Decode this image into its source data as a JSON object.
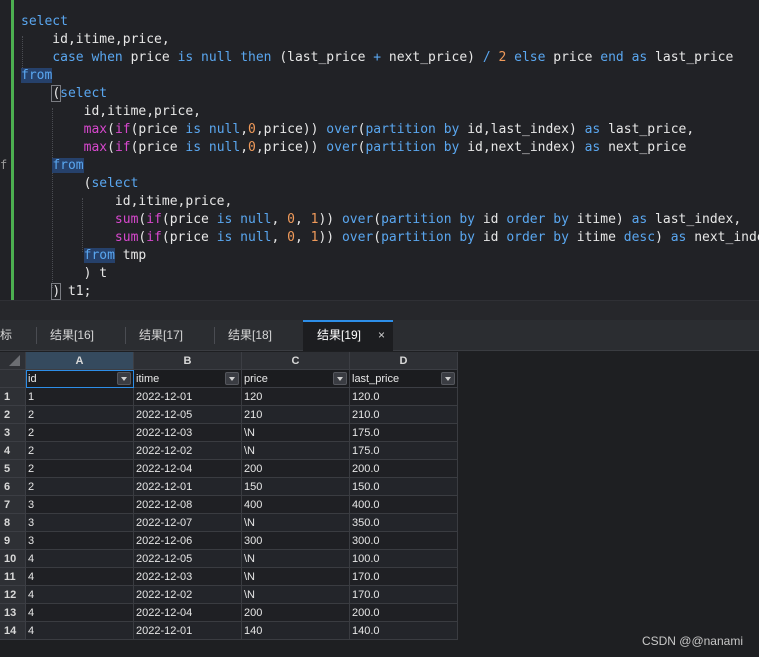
{
  "editor": {
    "lines": [
      [
        [
          "kw",
          "select"
        ]
      ],
      [
        [
          "pl",
          "    id,itime,price,"
        ]
      ],
      [
        [
          "pl",
          "    "
        ],
        [
          "kw",
          "case"
        ],
        [
          "pl",
          " "
        ],
        [
          "kw",
          "when"
        ],
        [
          "pl",
          " price "
        ],
        [
          "kw",
          "is"
        ],
        [
          "pl",
          " "
        ],
        [
          "kw",
          "null"
        ],
        [
          "pl",
          " "
        ],
        [
          "kw",
          "then"
        ],
        [
          "pl",
          " (last_price "
        ],
        [
          "kw",
          "+"
        ],
        [
          "pl",
          " next_price) "
        ],
        [
          "kw",
          "/"
        ],
        [
          "pl",
          " "
        ],
        [
          "num",
          "2"
        ],
        [
          "pl",
          " "
        ],
        [
          "kw",
          "else"
        ],
        [
          "pl",
          " price "
        ],
        [
          "kw",
          "end"
        ],
        [
          "pl",
          " "
        ],
        [
          "kw",
          "as"
        ],
        [
          "pl",
          " last_price"
        ]
      ],
      [
        [
          "kw hl",
          "from"
        ]
      ],
      [
        [
          "pl",
          "    "
        ],
        [
          "pl brk",
          "("
        ],
        [
          "kw",
          "select"
        ]
      ],
      [
        [
          "pl",
          "        id,itime,price,"
        ]
      ],
      [
        [
          "pl",
          "        "
        ],
        [
          "fn",
          "max"
        ],
        [
          "pl",
          "("
        ],
        [
          "fn",
          "if"
        ],
        [
          "pl",
          "(price "
        ],
        [
          "kw",
          "is"
        ],
        [
          "pl",
          " "
        ],
        [
          "kw",
          "null"
        ],
        [
          "pl",
          ","
        ],
        [
          "num",
          "0"
        ],
        [
          "pl",
          ",price)) "
        ],
        [
          "kw",
          "over"
        ],
        [
          "pl",
          "("
        ],
        [
          "kw",
          "partition"
        ],
        [
          "pl",
          " "
        ],
        [
          "kw",
          "by"
        ],
        [
          "pl",
          " id,last_index) "
        ],
        [
          "kw",
          "as"
        ],
        [
          "pl",
          " last_price,"
        ]
      ],
      [
        [
          "pl",
          "        "
        ],
        [
          "fn",
          "max"
        ],
        [
          "pl",
          "("
        ],
        [
          "fn",
          "if"
        ],
        [
          "pl",
          "(price "
        ],
        [
          "kw",
          "is"
        ],
        [
          "pl",
          " "
        ],
        [
          "kw",
          "null"
        ],
        [
          "pl",
          ","
        ],
        [
          "num",
          "0"
        ],
        [
          "pl",
          ",price)) "
        ],
        [
          "kw",
          "over"
        ],
        [
          "pl",
          "("
        ],
        [
          "kw",
          "partition"
        ],
        [
          "pl",
          " "
        ],
        [
          "kw",
          "by"
        ],
        [
          "pl",
          " id,next_index) "
        ],
        [
          "kw",
          "as"
        ],
        [
          "pl",
          " next_price"
        ]
      ],
      [
        [
          "pl",
          "    "
        ],
        [
          "kw hl",
          "from"
        ]
      ],
      [
        [
          "pl",
          "        ("
        ],
        [
          "kw",
          "select"
        ]
      ],
      [
        [
          "pl",
          "            id,itime,price,"
        ]
      ],
      [
        [
          "pl",
          "            "
        ],
        [
          "fn",
          "sum"
        ],
        [
          "pl",
          "("
        ],
        [
          "fn",
          "if"
        ],
        [
          "pl",
          "(price "
        ],
        [
          "kw",
          "is"
        ],
        [
          "pl",
          " "
        ],
        [
          "kw",
          "null"
        ],
        [
          "pl",
          ", "
        ],
        [
          "num",
          "0"
        ],
        [
          "pl",
          ", "
        ],
        [
          "num",
          "1"
        ],
        [
          "pl",
          ")) "
        ],
        [
          "kw",
          "over"
        ],
        [
          "pl",
          "("
        ],
        [
          "kw",
          "partition"
        ],
        [
          "pl",
          " "
        ],
        [
          "kw",
          "by"
        ],
        [
          "pl",
          " id "
        ],
        [
          "kw",
          "order"
        ],
        [
          "pl",
          " "
        ],
        [
          "kw",
          "by"
        ],
        [
          "pl",
          " itime) "
        ],
        [
          "kw",
          "as"
        ],
        [
          "pl",
          " last_index,"
        ]
      ],
      [
        [
          "pl",
          "            "
        ],
        [
          "fn",
          "sum"
        ],
        [
          "pl",
          "("
        ],
        [
          "fn",
          "if"
        ],
        [
          "pl",
          "(price "
        ],
        [
          "kw",
          "is"
        ],
        [
          "pl",
          " "
        ],
        [
          "kw",
          "null"
        ],
        [
          "pl",
          ", "
        ],
        [
          "num",
          "0"
        ],
        [
          "pl",
          ", "
        ],
        [
          "num",
          "1"
        ],
        [
          "pl",
          ")) "
        ],
        [
          "kw",
          "over"
        ],
        [
          "pl",
          "("
        ],
        [
          "kw",
          "partition"
        ],
        [
          "pl",
          " "
        ],
        [
          "kw",
          "by"
        ],
        [
          "pl",
          " id "
        ],
        [
          "kw",
          "order"
        ],
        [
          "pl",
          " "
        ],
        [
          "kw",
          "by"
        ],
        [
          "pl",
          " itime "
        ],
        [
          "kw",
          "desc"
        ],
        [
          "pl",
          ") "
        ],
        [
          "kw",
          "as"
        ],
        [
          "pl",
          " next_index"
        ]
      ],
      [
        [
          "pl",
          "        "
        ],
        [
          "kw hl",
          "from"
        ],
        [
          "pl",
          " tmp"
        ]
      ],
      [
        [
          "pl",
          "        ) t"
        ]
      ],
      [
        [
          "pl",
          "    "
        ],
        [
          "pl brk",
          ")"
        ],
        [
          "pl",
          " t1;"
        ]
      ]
    ],
    "gutter_mark": "f"
  },
  "tabs": {
    "partial": "标",
    "items": [
      "结果[16]",
      "结果[17]",
      "结果[18]",
      "结果[19]"
    ],
    "active_index": 3,
    "close": "×"
  },
  "grid": {
    "col_letters": [
      "A",
      "B",
      "C",
      "D"
    ],
    "headers": [
      "id",
      "itime",
      "price",
      "last_price"
    ],
    "row_numbers": [
      "1",
      "2",
      "3",
      "4",
      "5",
      "6",
      "7",
      "8",
      "9",
      "10",
      "11",
      "12",
      "13",
      "14"
    ],
    "rows": [
      [
        "1",
        "2022-12-01",
        "120",
        "120.0"
      ],
      [
        "2",
        "2022-12-05",
        "210",
        "210.0"
      ],
      [
        "2",
        "2022-12-03",
        "\\N",
        "175.0"
      ],
      [
        "2",
        "2022-12-02",
        "\\N",
        "175.0"
      ],
      [
        "2",
        "2022-12-04",
        "200",
        "200.0"
      ],
      [
        "2",
        "2022-12-01",
        "150",
        "150.0"
      ],
      [
        "3",
        "2022-12-08",
        "400",
        "400.0"
      ],
      [
        "3",
        "2022-12-07",
        "\\N",
        "350.0"
      ],
      [
        "3",
        "2022-12-06",
        "300",
        "300.0"
      ],
      [
        "4",
        "2022-12-05",
        "\\N",
        "100.0"
      ],
      [
        "4",
        "2022-12-03",
        "\\N",
        "170.0"
      ],
      [
        "4",
        "2022-12-02",
        "\\N",
        "170.0"
      ],
      [
        "4",
        "2022-12-04",
        "200",
        "200.0"
      ],
      [
        "4",
        "2022-12-01",
        "140",
        "140.0"
      ]
    ]
  },
  "watermark": "CSDN @@nanami"
}
